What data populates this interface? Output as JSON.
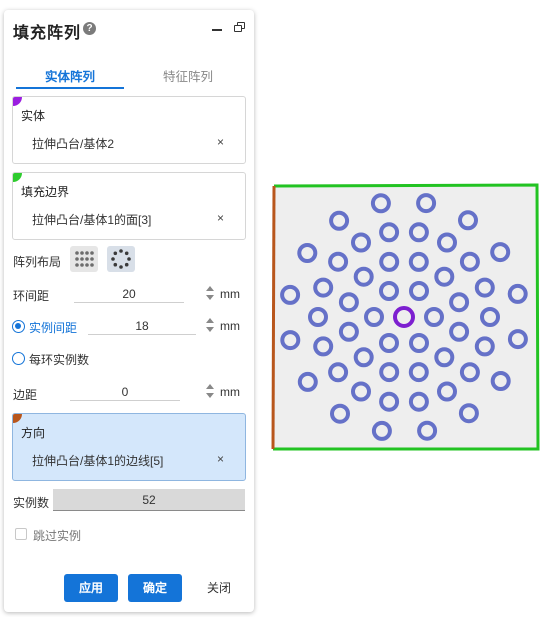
{
  "panel": {
    "title": "填充阵列",
    "help_icon": "?",
    "tabs": [
      {
        "label": "实体阵列",
        "active": true
      },
      {
        "label": "特征阵列",
        "active": false
      }
    ],
    "entity": {
      "label": "实体",
      "value": "拉伸凸台/基体2",
      "clear": "×",
      "corner_color": "#9b1de0"
    },
    "boundary": {
      "label": "填充边界",
      "value": "拉伸凸台/基体1的面[3]",
      "clear": "×",
      "corner_color": "#2ecc2e"
    },
    "layout": {
      "label": "阵列布局",
      "options": [
        "grid-layout-icon",
        "circular-layout-icon"
      ],
      "selected": "circular-layout-icon"
    },
    "ring_spacing": {
      "label": "环间距",
      "value": "20",
      "unit": "mm"
    },
    "instance_spacing": {
      "label": "实例间距",
      "value": "18",
      "unit": "mm",
      "checked": true
    },
    "per_ring": {
      "label": "每环实例数",
      "checked": false
    },
    "margin": {
      "label": "边距",
      "value": "0",
      "unit": "mm"
    },
    "direction": {
      "label": "方向",
      "value": "拉伸凸台/基体1的边线[5]",
      "clear": "×",
      "corner_color": "#b8561c"
    },
    "instance_count": {
      "label": "实例数",
      "value": "52"
    },
    "skip": {
      "label": "跳过实例",
      "checked": false
    },
    "buttons": {
      "apply": "应用",
      "ok": "确定",
      "close": "关闭"
    }
  },
  "viewport": {
    "plate_color": "#eeeeee",
    "boundary_color": "#22c322",
    "direction_edge_color": "#b8561c",
    "source_color": "#7d1fd0",
    "instance_color": "#6571c8",
    "ring_spacing_mm": 20,
    "instance_spacing_mm": 18,
    "instance_count": 52
  }
}
